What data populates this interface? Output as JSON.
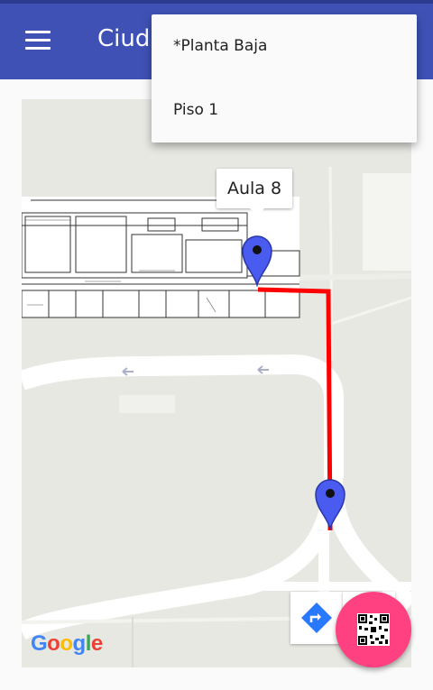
{
  "app_bar": {
    "title": "Ciuda",
    "color": "#3f51b5",
    "menu_icon": "hamburger-menu-icon"
  },
  "floor_menu": {
    "items": [
      {
        "label": "*Planta Baja"
      },
      {
        "label": "Piso 1"
      }
    ]
  },
  "map": {
    "callout_label": "Aula 8",
    "route_color": "#ff0000",
    "marker_color": "#4a5cf0",
    "google_logo": "Google"
  },
  "controls": {
    "directions_icon": "directions-icon",
    "fab_icon": "qr-code-icon",
    "fab_color": "#ff4081"
  }
}
